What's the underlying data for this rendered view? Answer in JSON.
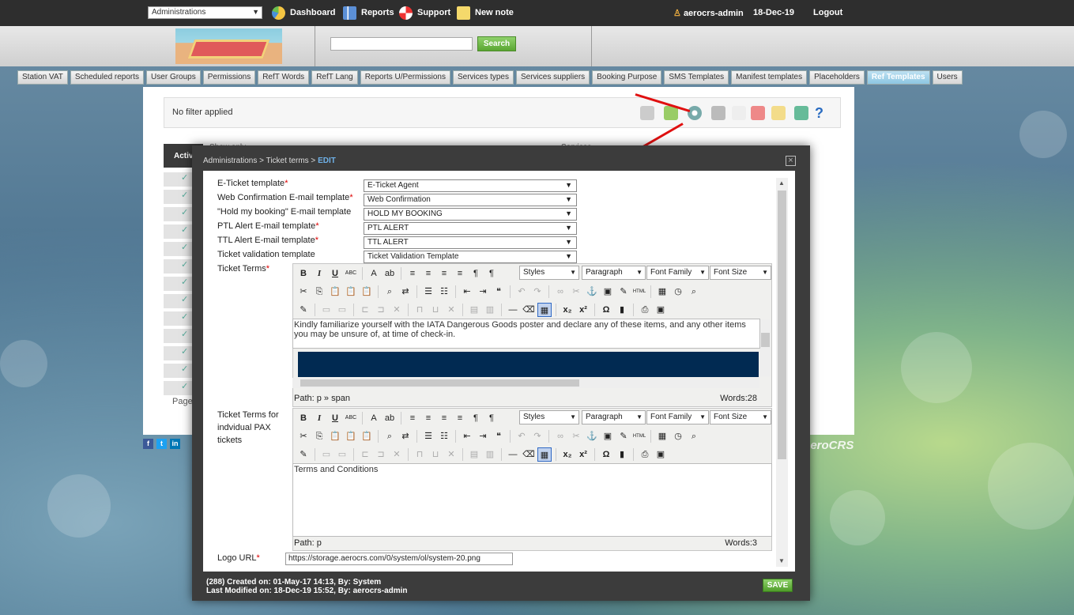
{
  "topbar": {
    "admin_select": "Administrations",
    "nav": [
      {
        "label": "Dashboard",
        "icon": "dashboard-icon"
      },
      {
        "label": "Reports",
        "icon": "reports-icon"
      },
      {
        "label": "Support",
        "icon": "support-icon"
      },
      {
        "label": "New note",
        "icon": "note-icon"
      }
    ],
    "user": "aerocrs-admin",
    "date": "18-Dec-19",
    "logout": "Logout"
  },
  "header": {
    "search_button": "Search"
  },
  "tabs": [
    "Station VAT",
    "Scheduled reports",
    "User Groups",
    "Permissions",
    "RefT Words",
    "RefT Lang",
    "Reports U/Permissions",
    "Services types",
    "Services suppliers",
    "Booking Purpose",
    "SMS Templates",
    "Manifest templates",
    "Placeholders",
    "Ref Templates",
    "Users"
  ],
  "active_tab": "Ref Templates",
  "list": {
    "filter_text": "No filter applied",
    "col_active": "Activ",
    "col_show_only": "Show only",
    "col_services": "Services",
    "page_label": "Page",
    "brand": "aeroCRS"
  },
  "modal": {
    "breadcrumb": "Administrations > Ticket terms > ",
    "breadcrumb_current": "EDIT",
    "fields": [
      {
        "label": "E-Ticket template",
        "required": true,
        "value": "E-Ticket Agent"
      },
      {
        "label": "Web Confirmation E-mail template",
        "required": true,
        "value": "Web Confirmation"
      },
      {
        "label": "\"Hold my booking\" E-mail template",
        "required": false,
        "value": "HOLD MY BOOKING"
      },
      {
        "label": "PTL Alert E-mail template",
        "required": true,
        "value": "PTL ALERT"
      },
      {
        "label": "TTL Alert E-mail template",
        "required": true,
        "value": "TTL ALERT"
      },
      {
        "label": "Ticket validation template",
        "required": false,
        "value": "Ticket Validation Template"
      }
    ],
    "editor1": {
      "label": "Ticket Terms",
      "text": "Kindly familiarize yourself with the IATA Dangerous Goods poster and declare any of these items, and any other items you may be unsure of, at time of check-in.",
      "path": "Path: p » span",
      "words": "Words:28"
    },
    "editor2": {
      "label": "Ticket Terms for indvidual PAX tickets",
      "text": "Terms and Conditions",
      "path": "Path: p",
      "words": "Words:3"
    },
    "toolbar": {
      "styles": "Styles",
      "paragraph": "Paragraph",
      "font_family": "Font Family",
      "font_size": "Font Size",
      "html": "HTML"
    },
    "logo_label": "Logo URL",
    "logo_value": "https://storage.aerocrs.com/0/system/ol/system-20.png",
    "footer_created": "(288) Created on: 01-May-17 14:13, By: System",
    "footer_modified": "Last Modified on: 18-Dec-19 15:52, By: aerocrs-admin",
    "save": "SAVE"
  }
}
